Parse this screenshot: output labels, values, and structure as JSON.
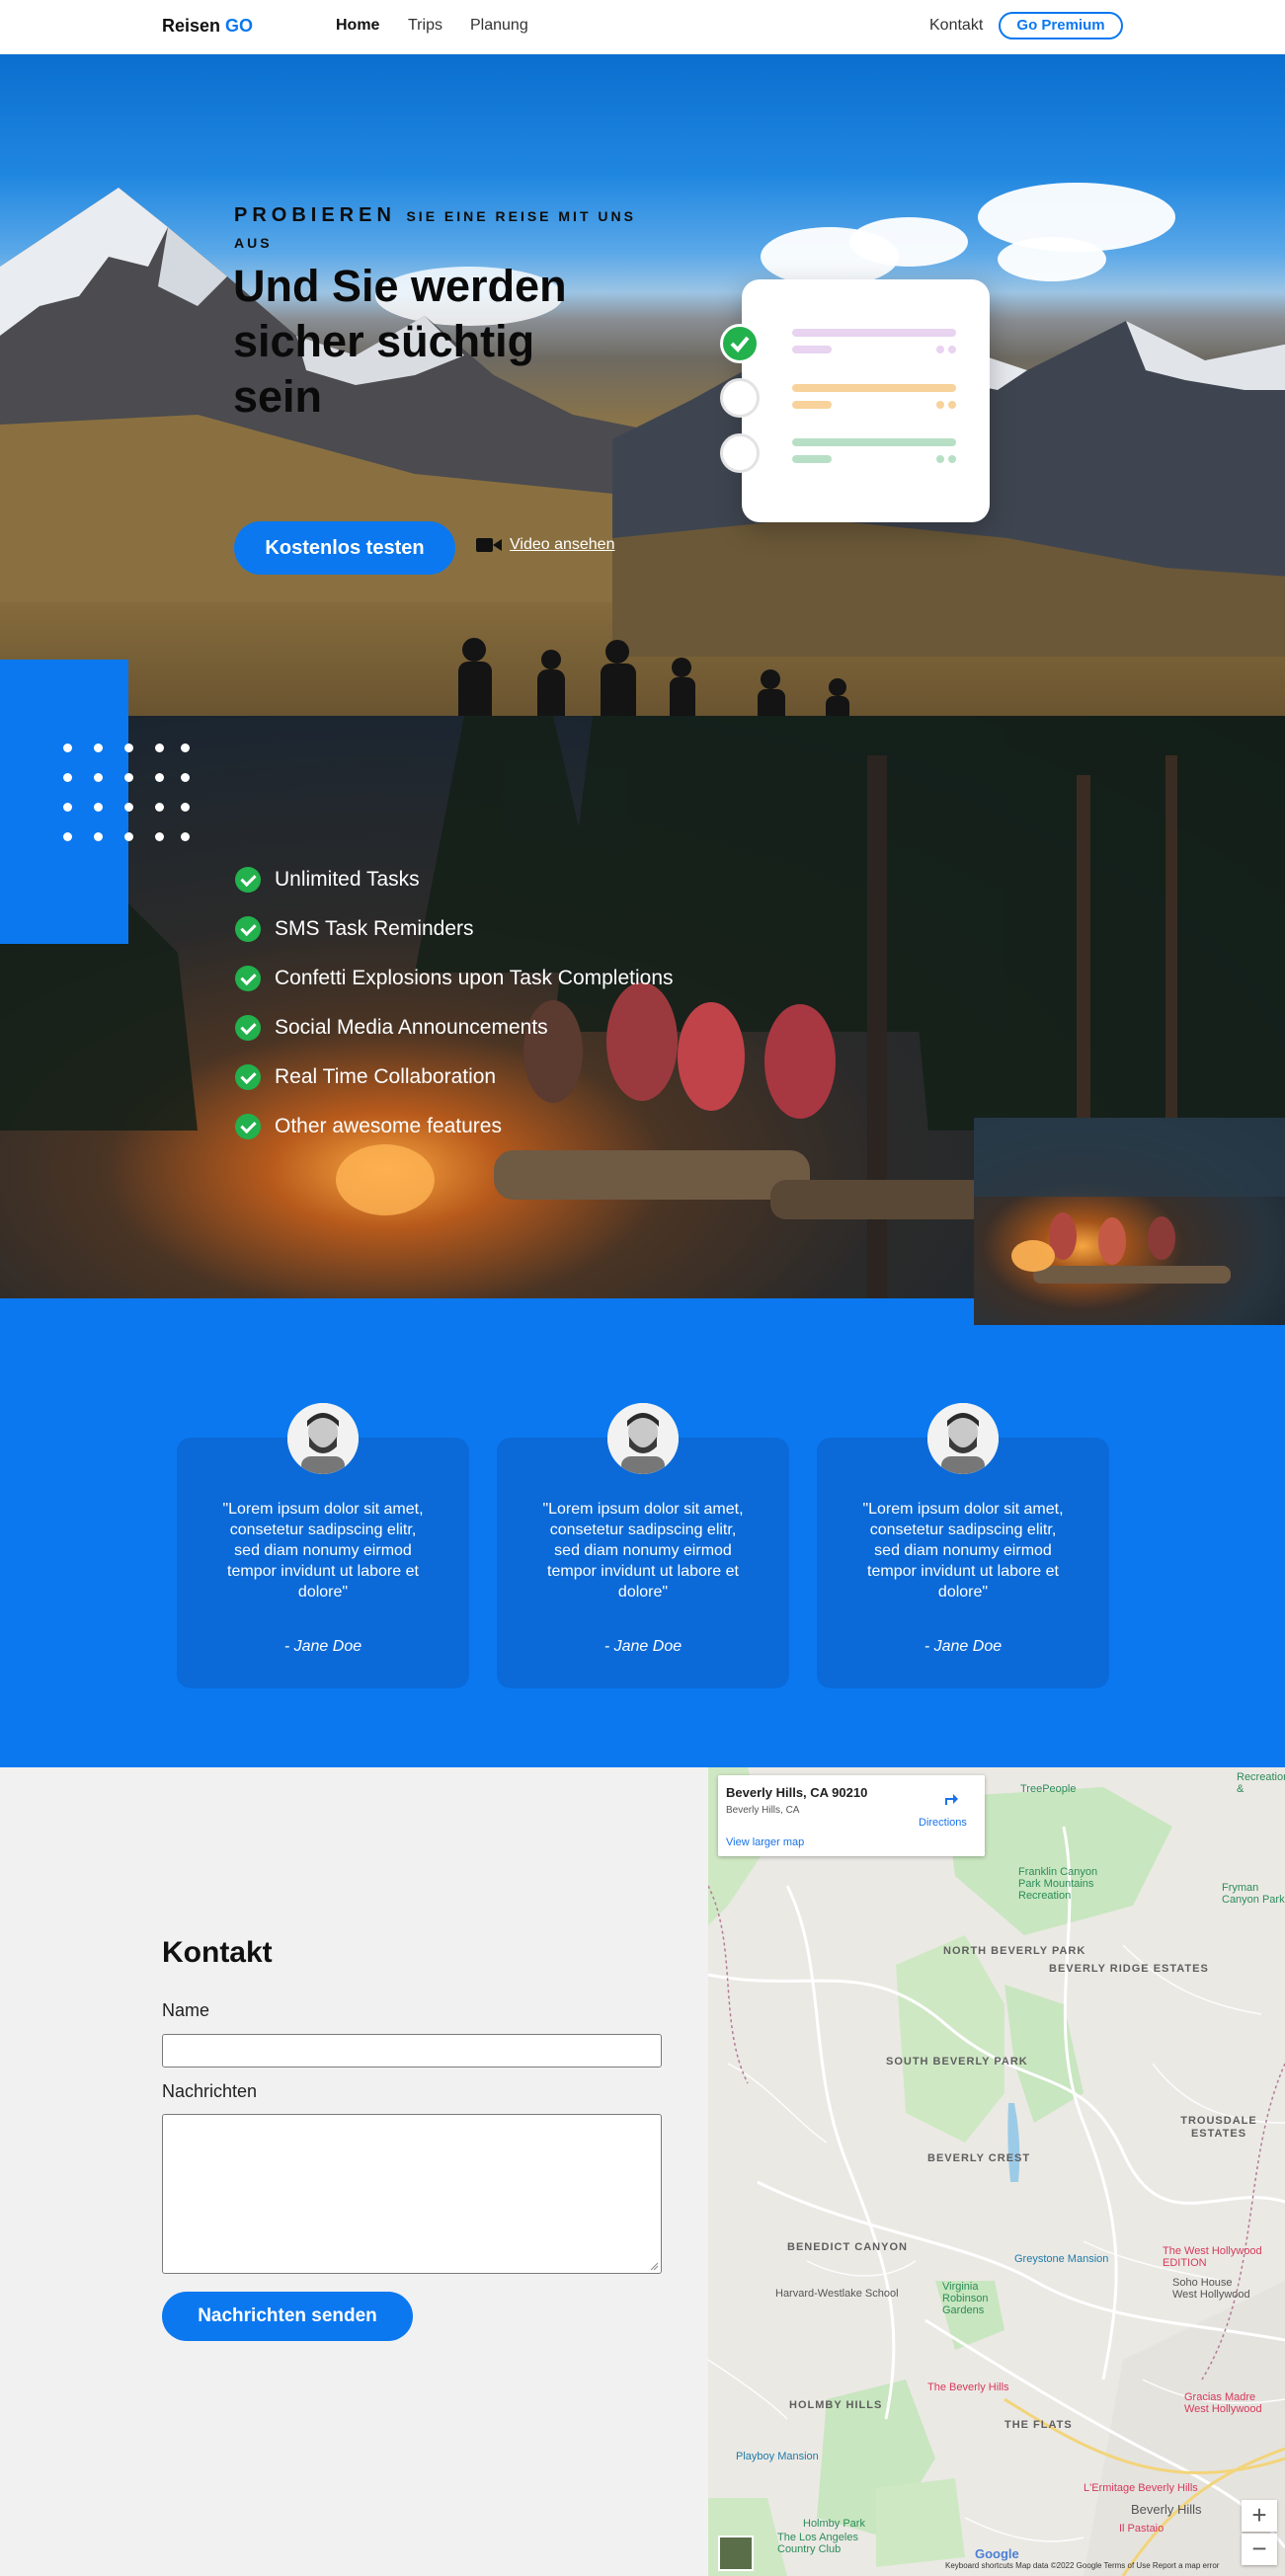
{
  "nav": {
    "brand_main": "Reisen",
    "brand_accent": "GO",
    "links": [
      "Home",
      "Trips",
      "Planung"
    ],
    "contact": "Kontakt",
    "premium": "Go Premium"
  },
  "hero": {
    "kicker_big": "PROBIEREN",
    "kicker_small": "SIE EINE REISE MIT UNS AUS",
    "title": "Und Sie werden sicher süchtig sein",
    "cta": "Kostenlos testen",
    "video": "Video ansehen",
    "card_colors": {
      "done": "#22b14c",
      "purple": "#e8d3f0",
      "orange": "#f7d29a",
      "green": "#b7dfc6"
    }
  },
  "features": {
    "items": [
      "Unlimited Tasks",
      "SMS Task Reminders",
      "Confetti Explosions upon Task Completions",
      "Social Media Announcements",
      "Real Time Collaboration",
      "Other awesome features"
    ]
  },
  "testimonials": [
    {
      "quote": "\"Lorem ipsum dolor sit amet, consetetur sadipscing elitr, sed diam nonumy eirmod tempor invidunt ut labore et dolore\"",
      "author": "- Jane Doe"
    },
    {
      "quote": "\"Lorem ipsum dolor sit amet, consetetur sadipscing elitr, sed diam nonumy eirmod tempor invidunt ut labore et dolore\"",
      "author": "- Jane Doe"
    },
    {
      "quote": "\"Lorem ipsum dolor sit amet, consetetur sadipscing elitr, sed diam nonumy eirmod tempor invidunt ut labore et dolore\"",
      "author": "- Jane Doe"
    }
  ],
  "contact": {
    "title": "Kontakt",
    "name_label": "Name",
    "message_label": "Nachrichten",
    "submit": "Nachrichten senden"
  },
  "map": {
    "address": "Beverly Hills, CA 90210",
    "subaddress": "Beverly Hills, CA",
    "view_larger": "View larger map",
    "directions": "Directions",
    "areas": [
      "NORTH BEVERLY PARK",
      "BEVERLY RIDGE ESTATES",
      "SOUTH BEVERLY PARK",
      "BEVERLY CREST",
      "TROUSDALE ESTATES",
      "BENEDICT CANYON",
      "HOLMBY HILLS",
      "THE FLATS"
    ],
    "pois": [
      "TreePeople",
      "Franklin Canyon Park Mountains Recreation",
      "Greystone Mansion",
      "Harvard-Westlake School",
      "Virginia Robinson Gardens",
      "The Beverly Hills",
      "Playboy Mansion",
      "Holmby Park",
      "The Los Angeles Country Club",
      "Beverly Hills",
      "L'Ermitage Beverly Hills",
      "Il Pastaio",
      "Soho House West Hollywood",
      "The West Hollywood EDITION",
      "Gracias Madre West Hollywood",
      "Fryman Canyon Park",
      "Recreation &"
    ],
    "footer": "Keyboard shortcuts   Map data ©2022 Google   Terms of Use   Report a map error",
    "google": "Google",
    "zoom_in": "+",
    "zoom_out": "−"
  }
}
